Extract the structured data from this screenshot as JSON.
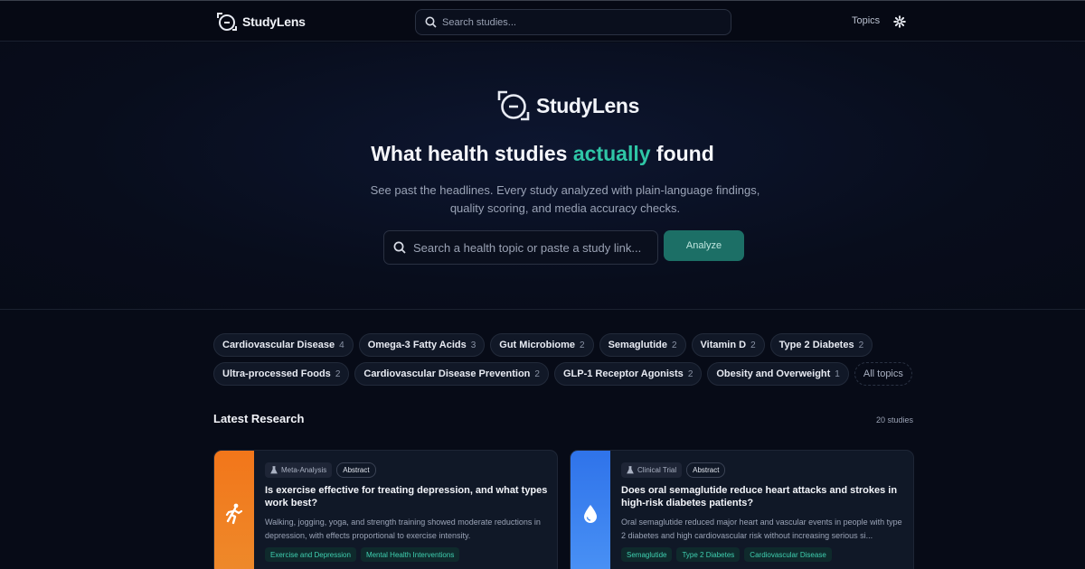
{
  "nav": {
    "brand": "StudyLens",
    "search_placeholder": "Search studies...",
    "topics_label": "Topics",
    "settings_icon": "gear-icon"
  },
  "hero": {
    "brand": "StudyLens",
    "headline_pre": "What health studies",
    "headline_accent": "actually",
    "headline_post": "found",
    "subtitle": "See past the headlines. Every study analyzed with plain-language findings, quality scoring, and media accuracy checks.",
    "search_placeholder": "Search a health topic or paste a study link...",
    "analyze_label": "Analyze"
  },
  "topics": [
    {
      "label": "Cardiovascular Disease",
      "count": "4"
    },
    {
      "label": "Omega-3 Fatty Acids",
      "count": "3"
    },
    {
      "label": "Gut Microbiome",
      "count": "2"
    },
    {
      "label": "Semaglutide",
      "count": "2"
    },
    {
      "label": "Vitamin D",
      "count": "2"
    },
    {
      "label": "Type 2 Diabetes",
      "count": "2"
    },
    {
      "label": "Ultra-processed Foods",
      "count": "2"
    },
    {
      "label": "Cardiovascular Disease Prevention",
      "count": "2"
    },
    {
      "label": "GLP-1 Receptor Agonists",
      "count": "2"
    },
    {
      "label": "Obesity and Overweight",
      "count": "1"
    }
  ],
  "all_topics_label": "All topics",
  "latest": {
    "title": "Latest Research",
    "count": "20 studies"
  },
  "studies": [
    {
      "type": "Meta-Analysis",
      "badge": "Abstract",
      "title": "Is exercise effective for treating depression, and what types work best?",
      "summary": "Walking, jogging, yoga, and strength training showed moderate reductions in depression, with effects proportional to exercise intensity.",
      "topics": [
        "Exercise and Depression",
        "Mental Health Interventions"
      ],
      "icon": "running-person-icon",
      "color": "#f07a1f"
    },
    {
      "type": "Clinical Trial",
      "badge": "Abstract",
      "title": "Does oral semaglutide reduce heart attacks and strokes in high-risk diabetes patients?",
      "summary": "Oral semaglutide reduced major heart and vascular events in people with type 2 diabetes and high cardiovascular risk without increasing serious si...",
      "topics": [
        "Semaglutide",
        "Type 2 Diabetes",
        "Cardiovascular Disease"
      ],
      "icon": "drop-icon",
      "color": "#3b82f6"
    }
  ]
}
